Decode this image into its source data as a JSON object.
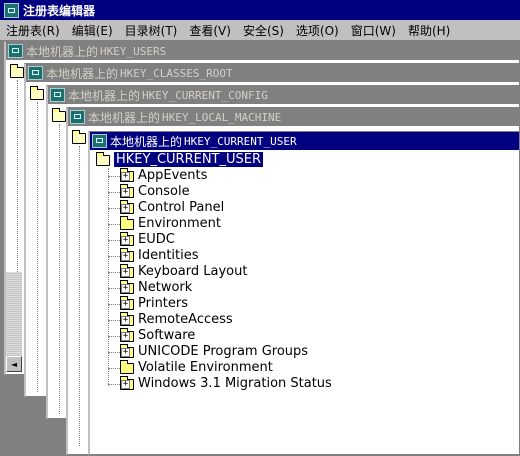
{
  "app": {
    "title": "注册表编辑器"
  },
  "menu": [
    {
      "label": "注册表(R)"
    },
    {
      "label": "编辑(E)"
    },
    {
      "label": "目录树(T)"
    },
    {
      "label": "查看(V)"
    },
    {
      "label": "安全(S)"
    },
    {
      "label": "选项(O)"
    },
    {
      "label": "窗口(W)"
    },
    {
      "label": "帮助(H)"
    }
  ],
  "windows": [
    {
      "prefix": "本地机器上的",
      "hive": "HKEY_USERS"
    },
    {
      "prefix": "本地机器上的",
      "hive": "HKEY_CLASSES_ROOT"
    },
    {
      "prefix": "本地机器上的",
      "hive": "HKEY_CURRENT_CONFIG"
    },
    {
      "prefix": "本地机器上的",
      "hive": "HKEY_LOCAL_MACHINE"
    },
    {
      "prefix": "本地机器上的",
      "hive": "HKEY_CURRENT_USER"
    }
  ],
  "tree": {
    "root": "HKEY_CURRENT_USER",
    "children": [
      {
        "label": "AppEvents",
        "expandable": true
      },
      {
        "label": "Console",
        "expandable": true
      },
      {
        "label": "Control Panel",
        "expandable": true
      },
      {
        "label": "Environment",
        "expandable": false
      },
      {
        "label": "EUDC",
        "expandable": true
      },
      {
        "label": "Identities",
        "expandable": true
      },
      {
        "label": "Keyboard Layout",
        "expandable": true
      },
      {
        "label": "Network",
        "expandable": true
      },
      {
        "label": "Printers",
        "expandable": true
      },
      {
        "label": "RemoteAccess",
        "expandable": true
      },
      {
        "label": "Software",
        "expandable": true
      },
      {
        "label": "UNICODE Program Groups",
        "expandable": true
      },
      {
        "label": "Volatile Environment",
        "expandable": false
      },
      {
        "label": "Windows 3.1 Migration Status",
        "expandable": true
      }
    ]
  }
}
